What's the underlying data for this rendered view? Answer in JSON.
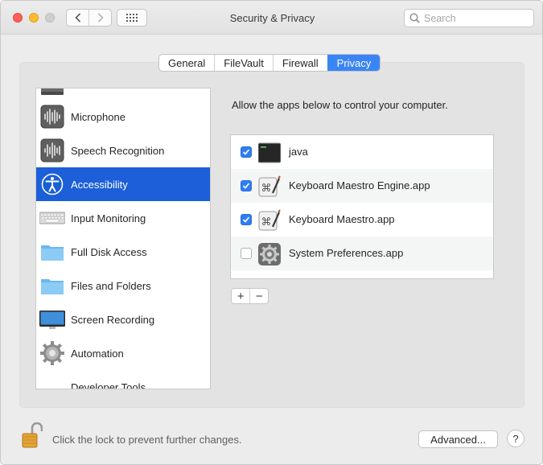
{
  "window": {
    "title": "Security & Privacy",
    "search_placeholder": "Search"
  },
  "tabs": [
    {
      "label": "General",
      "active": false
    },
    {
      "label": "FileVault",
      "active": false
    },
    {
      "label": "Firewall",
      "active": false
    },
    {
      "label": "Privacy",
      "active": true
    }
  ],
  "sidebar": {
    "items": [
      {
        "label": "Microphone",
        "icon": "microphone-icon"
      },
      {
        "label": "Speech Recognition",
        "icon": "speech-recognition-icon"
      },
      {
        "label": "Accessibility",
        "icon": "accessibility-icon",
        "selected": true
      },
      {
        "label": "Input Monitoring",
        "icon": "keyboard-icon"
      },
      {
        "label": "Full Disk Access",
        "icon": "folder-icon"
      },
      {
        "label": "Files and Folders",
        "icon": "folder-icon"
      },
      {
        "label": "Screen Recording",
        "icon": "display-icon"
      },
      {
        "label": "Automation",
        "icon": "gear-icon"
      },
      {
        "label": "Developer Tools",
        "icon": "developer-tools-icon"
      }
    ]
  },
  "main": {
    "description": "Allow the apps below to control your computer.",
    "apps": [
      {
        "name": "java",
        "checked": true,
        "icon": "terminal-icon"
      },
      {
        "name": "Keyboard Maestro Engine.app",
        "checked": true,
        "icon": "keyboard-maestro-icon"
      },
      {
        "name": "Keyboard Maestro.app",
        "checked": true,
        "icon": "keyboard-maestro-icon"
      },
      {
        "name": "System Preferences.app",
        "checked": false,
        "icon": "system-preferences-icon"
      }
    ],
    "add_label": "+",
    "remove_label": "−"
  },
  "footer": {
    "lock_text": "Click the lock to prevent further changes.",
    "advanced_label": "Advanced...",
    "help_label": "?"
  },
  "colors": {
    "accent": "#3a85f5",
    "selection": "#1c5fd8",
    "close": "#fc5f57",
    "minimize": "#fdbc2e",
    "lock": "#e0a030"
  }
}
